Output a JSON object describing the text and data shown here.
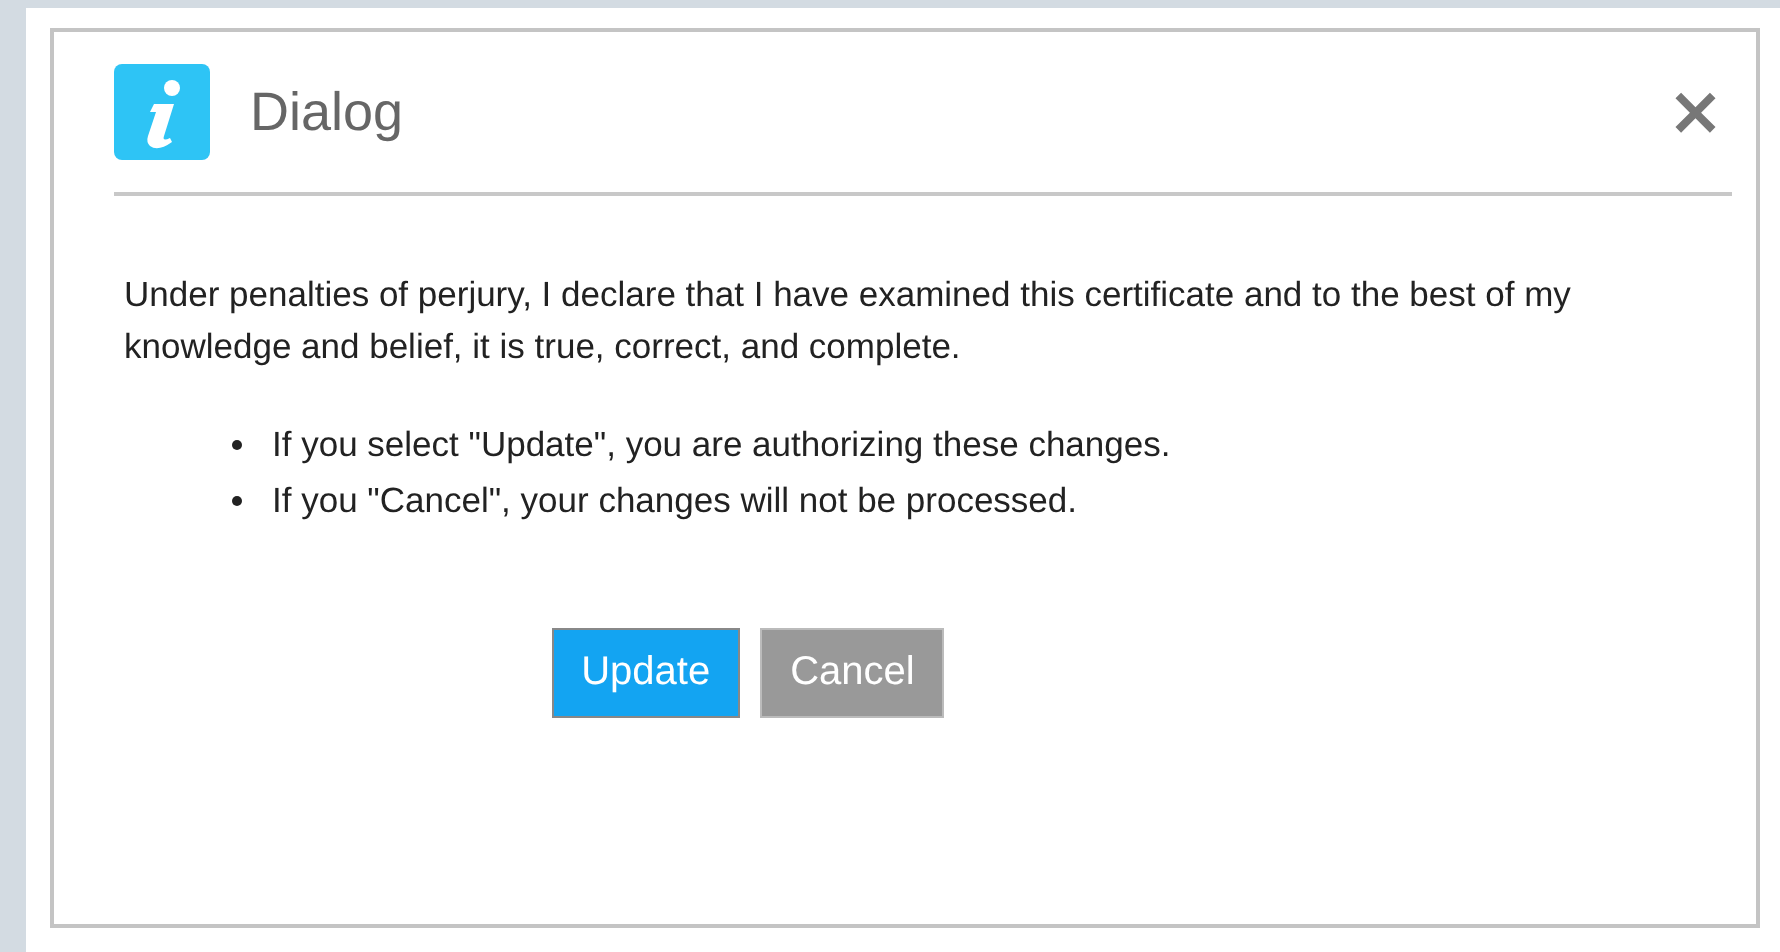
{
  "dialog": {
    "title": "Dialog",
    "close": "×",
    "message": "Under penalties of perjury, I declare that I have examined this certificate and to the best of my knowledge and belief, it is true, correct, and complete.",
    "bullets": [
      "If you select \"Update\", you are authorizing these changes.",
      "If you \"Cancel\", your changes will not be processed."
    ],
    "buttons": [
      {
        "label": "Update",
        "kind": "primary"
      },
      {
        "label": "Cancel",
        "kind": "secondary"
      }
    ]
  }
}
